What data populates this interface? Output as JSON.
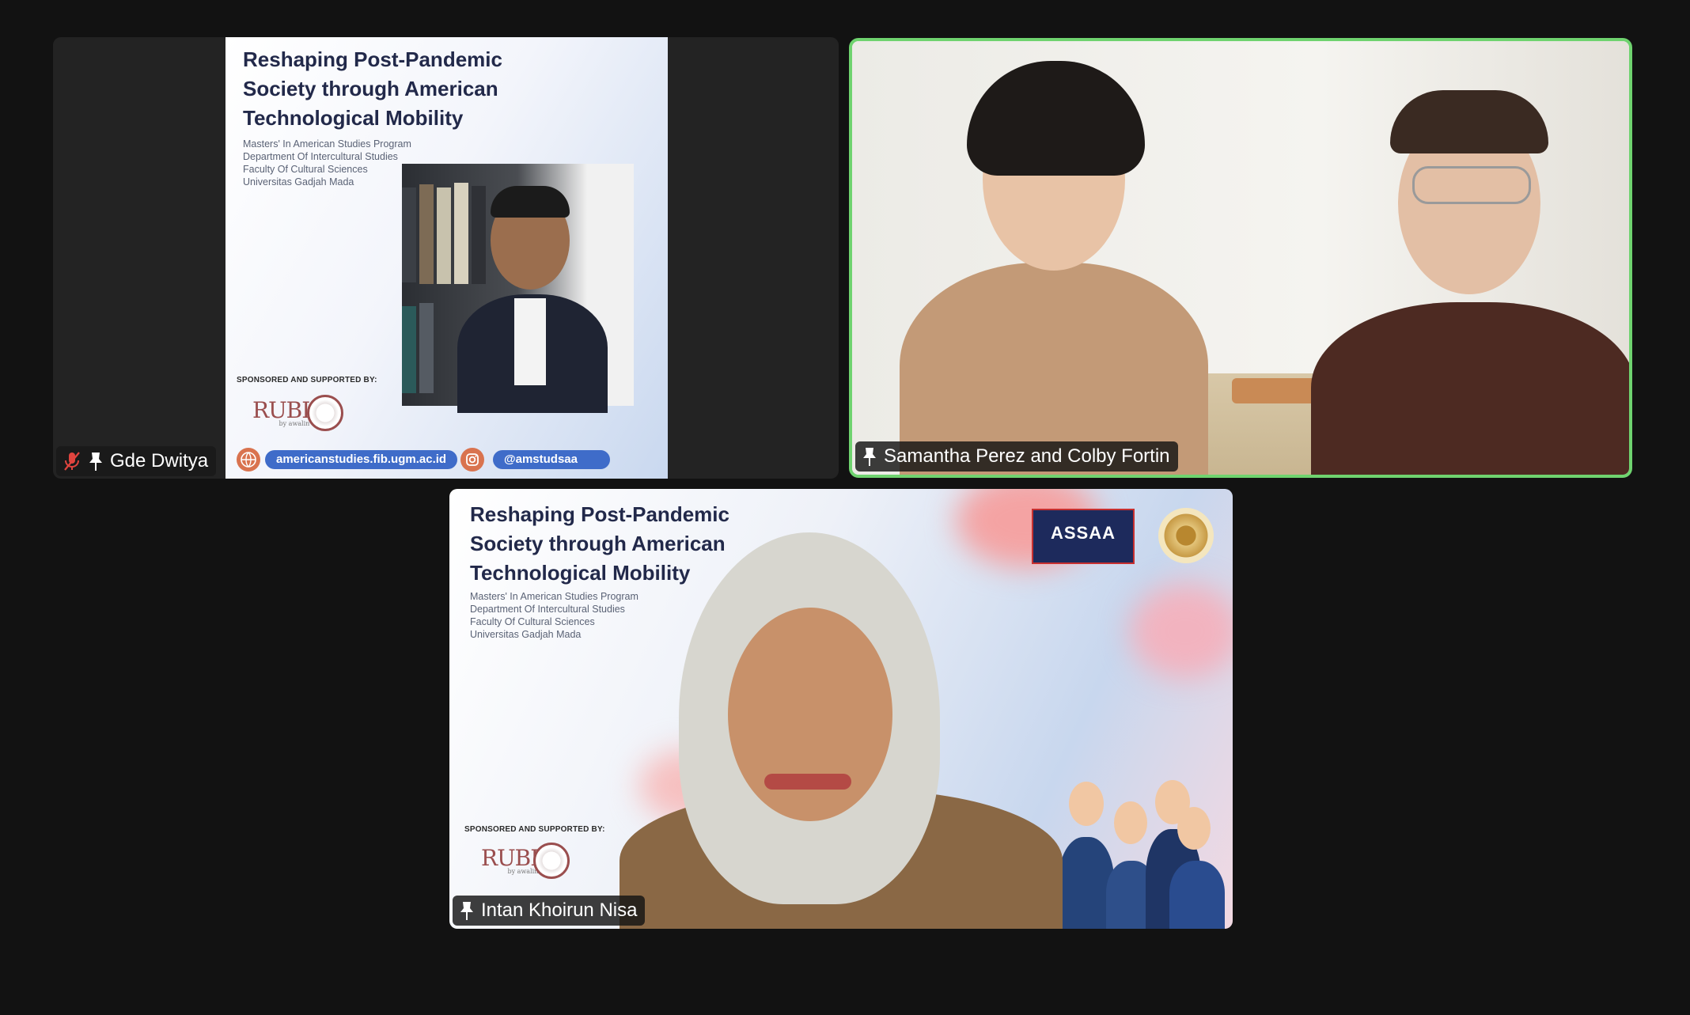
{
  "participants": [
    {
      "name": "Gde Dwitya",
      "muted": true,
      "pinned": true,
      "slide": {
        "title_lines": [
          "Reshaping Post-Pandemic",
          "Society through American",
          "Technological Mobility"
        ],
        "subtitle_lines": [
          "Masters' In American Studies Program",
          "Department Of Intercultural Studies",
          "Faculty Of Cultural Sciences",
          "Universitas Gadjah Mada"
        ],
        "sponsor_text": "SPONSORED AND SUPPORTED BY:",
        "rubi": "RUBI",
        "rubi_sub": "by awalin",
        "website": "americanstudies.fib.ugm.ac.id",
        "instagram": "@amstudsaa"
      }
    },
    {
      "name": "Samantha Perez and Colby Fortin",
      "muted": false,
      "pinned": true,
      "active_speaker": true,
      "active_border_color": "#6fd36f"
    },
    {
      "name": "Intan Khoirun Nisa",
      "muted": false,
      "pinned": true,
      "slide": {
        "title_lines": [
          "Reshaping Post-Pandemic",
          "Society through American",
          "Technological Mobility"
        ],
        "subtitle_lines": [
          "Masters' In American Studies Program",
          "Department Of Intercultural Studies",
          "Faculty Of Cultural Sciences",
          "Universitas Gadjah Mada"
        ],
        "sponsor_text": "SPONSORED AND SUPPORTED BY:",
        "rubi": "RUBI",
        "rubi_sub": "by awalin",
        "logo_text": "ASSAA"
      }
    }
  ],
  "icons": {
    "mute": "microphone-muted-icon",
    "pin": "pin-icon",
    "globe": "globe-icon",
    "instagram": "instagram-icon"
  },
  "colors": {
    "background": "#121212",
    "tile": "#232323",
    "active_speaker": "#6fd36f",
    "mute_red": "#e0443e",
    "pill_blue": "#3f6cc9"
  }
}
